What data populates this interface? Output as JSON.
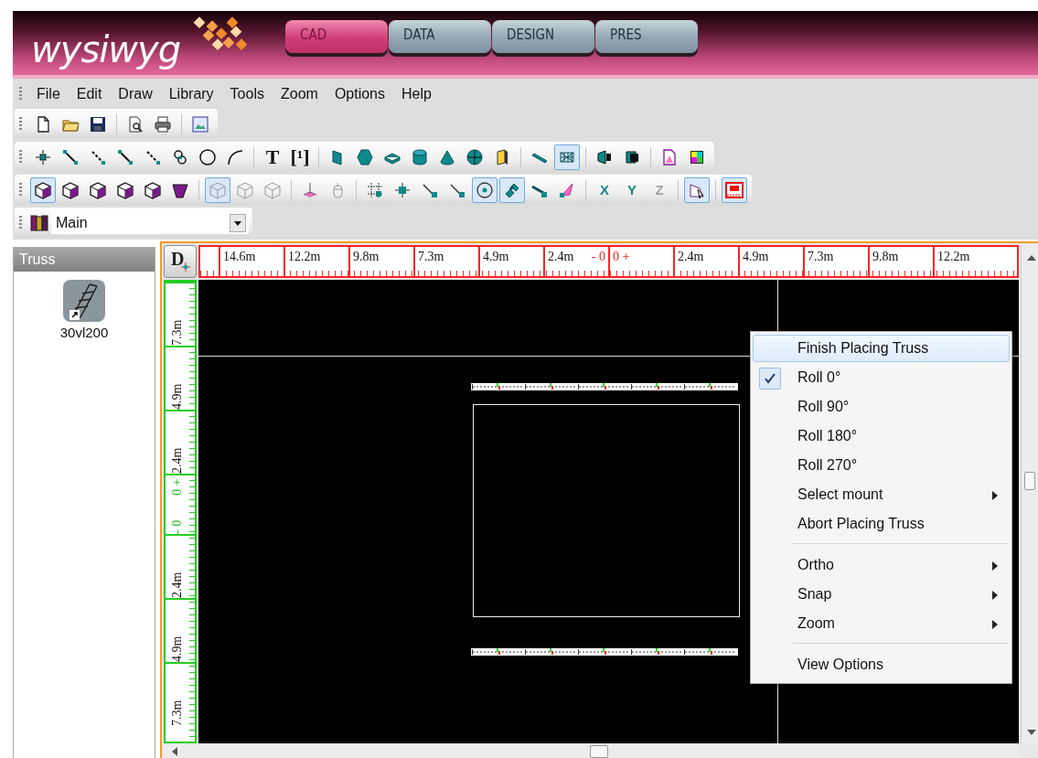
{
  "logo": {
    "text": "wysiwyg"
  },
  "mode_tabs": [
    {
      "label": "CAD",
      "selected": true
    },
    {
      "label": "DATA",
      "selected": false
    },
    {
      "label": "DESIGN",
      "selected": false
    },
    {
      "label": "PRES",
      "selected": false
    }
  ],
  "menu_bar": [
    "File",
    "Edit",
    "Draw",
    "Library",
    "Tools",
    "Zoom",
    "Options",
    "Help"
  ],
  "toolbars": [
    [
      {
        "kind": "icon",
        "selected": false
      },
      {
        "kind": "icon",
        "selected": false
      },
      {
        "kind": "icon",
        "selected": false
      },
      {
        "kind": "separator"
      },
      {
        "kind": "icon",
        "selected": false
      },
      {
        "kind": "icon",
        "selected": false
      },
      {
        "kind": "separator"
      },
      {
        "kind": "icon",
        "selected": false
      }
    ],
    [
      {
        "kind": "icon",
        "selected": false
      },
      {
        "kind": "icon",
        "selected": false
      },
      {
        "kind": "icon",
        "selected": false
      },
      {
        "kind": "icon",
        "selected": false
      },
      {
        "kind": "icon",
        "selected": false
      },
      {
        "kind": "icon",
        "selected": false
      },
      {
        "kind": "icon",
        "selected": false
      },
      {
        "kind": "icon",
        "selected": false
      },
      {
        "kind": "separator"
      },
      {
        "kind": "letter",
        "label": "T",
        "selected": false
      },
      {
        "kind": "letter",
        "label": "[¹]",
        "selected": false
      },
      {
        "kind": "separator"
      },
      {
        "kind": "icon",
        "selected": false
      },
      {
        "kind": "icon",
        "selected": false
      },
      {
        "kind": "icon",
        "selected": false
      },
      {
        "kind": "icon",
        "selected": false
      },
      {
        "kind": "icon",
        "selected": false
      },
      {
        "kind": "icon",
        "selected": false
      },
      {
        "kind": "icon",
        "selected": false
      },
      {
        "kind": "separator"
      },
      {
        "kind": "icon",
        "selected": false
      },
      {
        "kind": "icon",
        "selected": true
      },
      {
        "kind": "separator"
      },
      {
        "kind": "icon",
        "selected": false
      },
      {
        "kind": "icon",
        "selected": false
      },
      {
        "kind": "separator"
      },
      {
        "kind": "icon",
        "selected": false
      },
      {
        "kind": "icon",
        "selected": false
      }
    ],
    [
      {
        "kind": "icon",
        "selected": true
      },
      {
        "kind": "icon",
        "selected": false
      },
      {
        "kind": "icon",
        "selected": false
      },
      {
        "kind": "icon",
        "selected": false
      },
      {
        "kind": "icon",
        "selected": false
      },
      {
        "kind": "icon",
        "selected": false
      },
      {
        "kind": "separator"
      },
      {
        "kind": "icon",
        "selected": true
      },
      {
        "kind": "icon",
        "selected": false
      },
      {
        "kind": "icon",
        "selected": false
      },
      {
        "kind": "separator"
      },
      {
        "kind": "icon",
        "selected": false
      },
      {
        "kind": "icon",
        "selected": false
      },
      {
        "kind": "separator"
      },
      {
        "kind": "icon",
        "selected": false
      },
      {
        "kind": "icon",
        "selected": false
      },
      {
        "kind": "icon",
        "selected": false
      },
      {
        "kind": "icon",
        "selected": false
      },
      {
        "kind": "icon",
        "selected": true
      },
      {
        "kind": "icon",
        "selected": true
      },
      {
        "kind": "icon",
        "selected": false
      },
      {
        "kind": "icon",
        "selected": false
      },
      {
        "kind": "separator"
      },
      {
        "kind": "letter",
        "label": "X",
        "selected": false,
        "disabled": false
      },
      {
        "kind": "letter",
        "label": "Y",
        "selected": false,
        "disabled": false
      },
      {
        "kind": "letter",
        "label": "Z",
        "selected": false,
        "disabled": true
      },
      {
        "kind": "separator"
      },
      {
        "kind": "icon",
        "selected": true
      },
      {
        "kind": "separator"
      },
      {
        "kind": "icon",
        "selected": true
      }
    ]
  ],
  "layer_select": {
    "value": "Main"
  },
  "library_panel": {
    "title": "Truss",
    "items": [
      {
        "label": "30vl200"
      }
    ]
  },
  "ruler_corner": {
    "label": "D"
  },
  "horizontal_ruler": [
    {
      "kind": "label",
      "text": "14.6m"
    },
    {
      "kind": "label",
      "text": "12.2m"
    },
    {
      "kind": "label",
      "text": "9.8m"
    },
    {
      "kind": "label",
      "text": "7.3m"
    },
    {
      "kind": "label",
      "text": "4.9m"
    },
    {
      "kind": "label",
      "text": "2.4m"
    },
    {
      "kind": "zero",
      "text": "- 0"
    },
    {
      "kind": "zero",
      "text": "0 +"
    },
    {
      "kind": "label",
      "text": "2.4m"
    },
    {
      "kind": "label",
      "text": "4.9m"
    },
    {
      "kind": "label",
      "text": "7.3m"
    },
    {
      "kind": "label",
      "text": "9.8m"
    },
    {
      "kind": "label",
      "text": "12.2m"
    }
  ],
  "vertical_ruler": [
    {
      "kind": "label",
      "text": "7.3m"
    },
    {
      "kind": "label",
      "text": "4.9m"
    },
    {
      "kind": "label",
      "text": "2.4m"
    },
    {
      "kind": "zero",
      "text": "0 +"
    },
    {
      "kind": "zero",
      "text": "- 0"
    },
    {
      "kind": "label",
      "text": "2.4m"
    },
    {
      "kind": "label",
      "text": "4.9m"
    },
    {
      "kind": "label",
      "text": "7.3m"
    }
  ],
  "context_menu": [
    {
      "kind": "item",
      "label": "Finish Placing Truss",
      "selected": true,
      "checked": false,
      "submenu": false
    },
    {
      "kind": "item",
      "label": "Roll 0°",
      "selected": false,
      "checked": true,
      "submenu": false
    },
    {
      "kind": "item",
      "label": "Roll 90°",
      "selected": false,
      "checked": false,
      "submenu": false
    },
    {
      "kind": "item",
      "label": "Roll 180°",
      "selected": false,
      "checked": false,
      "submenu": false
    },
    {
      "kind": "item",
      "label": "Roll 270°",
      "selected": false,
      "checked": false,
      "submenu": false
    },
    {
      "kind": "item",
      "label": "Select mount",
      "selected": false,
      "checked": false,
      "submenu": true
    },
    {
      "kind": "item",
      "label": "Abort Placing Truss",
      "selected": false,
      "checked": false,
      "submenu": false
    },
    {
      "kind": "separator"
    },
    {
      "kind": "item",
      "label": "Ortho",
      "selected": false,
      "checked": false,
      "submenu": true
    },
    {
      "kind": "item",
      "label": "Snap",
      "selected": false,
      "checked": false,
      "submenu": true
    },
    {
      "kind": "item",
      "label": "Zoom",
      "selected": false,
      "checked": false,
      "submenu": true
    },
    {
      "kind": "separator"
    },
    {
      "kind": "item",
      "label": "View Options",
      "selected": false,
      "checked": false,
      "submenu": false
    }
  ]
}
